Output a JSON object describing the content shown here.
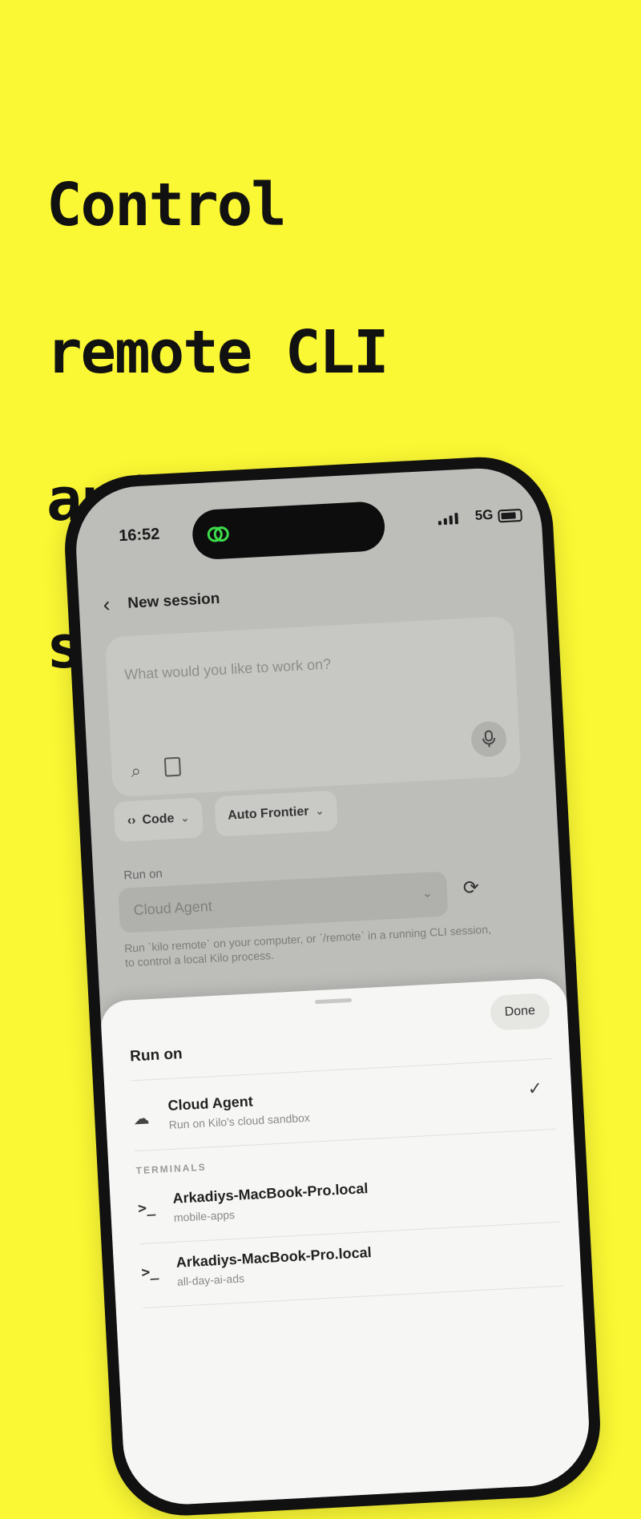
{
  "headline": {
    "lines": [
      "Control",
      "remote CLI",
      "and VS Code",
      "sessions"
    ]
  },
  "status_bar": {
    "time": "16:52",
    "network": "5G"
  },
  "nav": {
    "title": "New session"
  },
  "prompt": {
    "placeholder": "What would you like to work on?"
  },
  "chips": {
    "mode_label": "Code",
    "model_label": "Auto Frontier"
  },
  "run_on": {
    "label": "Run on",
    "selected_value": "Cloud Agent",
    "hint": "Run `kilo remote` on your computer, or `/remote` in a running CLI session, to control a local Kilo process."
  },
  "sheet": {
    "title": "Run on",
    "done_label": "Done",
    "cloud_option": {
      "title": "Cloud Agent",
      "subtitle": "Run on Kilo's cloud sandbox",
      "selected": true
    },
    "section_label": "TERMINALS",
    "terminals": [
      {
        "title": "Arkadiys-MacBook-Pro.local",
        "subtitle": "mobile-apps"
      },
      {
        "title": "Arkadiys-MacBook-Pro.local",
        "subtitle": "all-day-ai-ads"
      }
    ]
  },
  "colors": {
    "background": "#FAF734",
    "island_accent": "#3DDC4B"
  }
}
